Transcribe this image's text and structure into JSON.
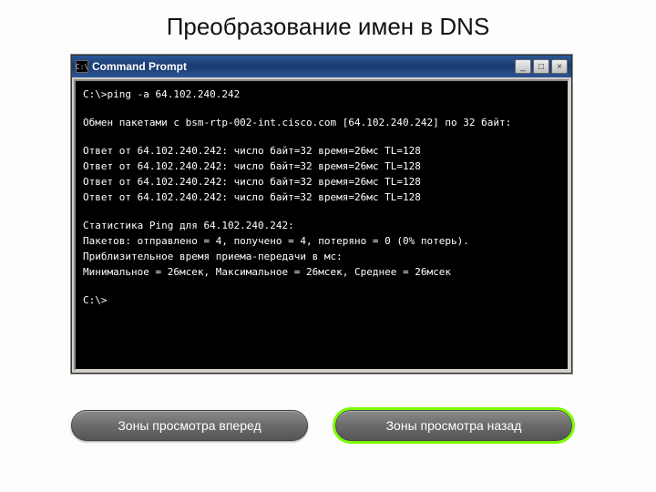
{
  "slide": {
    "title": "Преобразование имен в DNS"
  },
  "window": {
    "icon_glyph": "C:\\",
    "title": "Command Prompt",
    "buttons": {
      "minimize": "_",
      "maximize": "□",
      "close": "×"
    }
  },
  "terminal": {
    "l0": "C:\\>ping -a 64.102.240.242",
    "l1": "Обмен пакетами с bsm-rtp-002-int.cisco.com [64.102.240.242] по 32 байт:",
    "l2": "Ответ от 64.102.240.242: число байт=32 время=26мс TL=128",
    "l3": "Ответ от 64.102.240.242: число байт=32 время=26мс TL=128",
    "l4": "Ответ от 64.102.240.242: число байт=32 время=26мс TL=128",
    "l5": "Ответ от 64.102.240.242: число байт=32 время=26мс TL=128",
    "l6": "Статистика Ping для 64.102.240.242:",
    "l7": "Пакетов: отправлено = 4, получено = 4, потеряно = 0 (0% потерь).",
    "l8": "Приблизительное время приема-передачи в мс:",
    "l9": "Минимальное = 26мсек, Максимальное = 26мсек, Среднее = 26мсек",
    "l10": "C:\\>"
  },
  "nav": {
    "prev": "Зоны просмотра вперед",
    "next": "Зоны просмотра назад"
  }
}
